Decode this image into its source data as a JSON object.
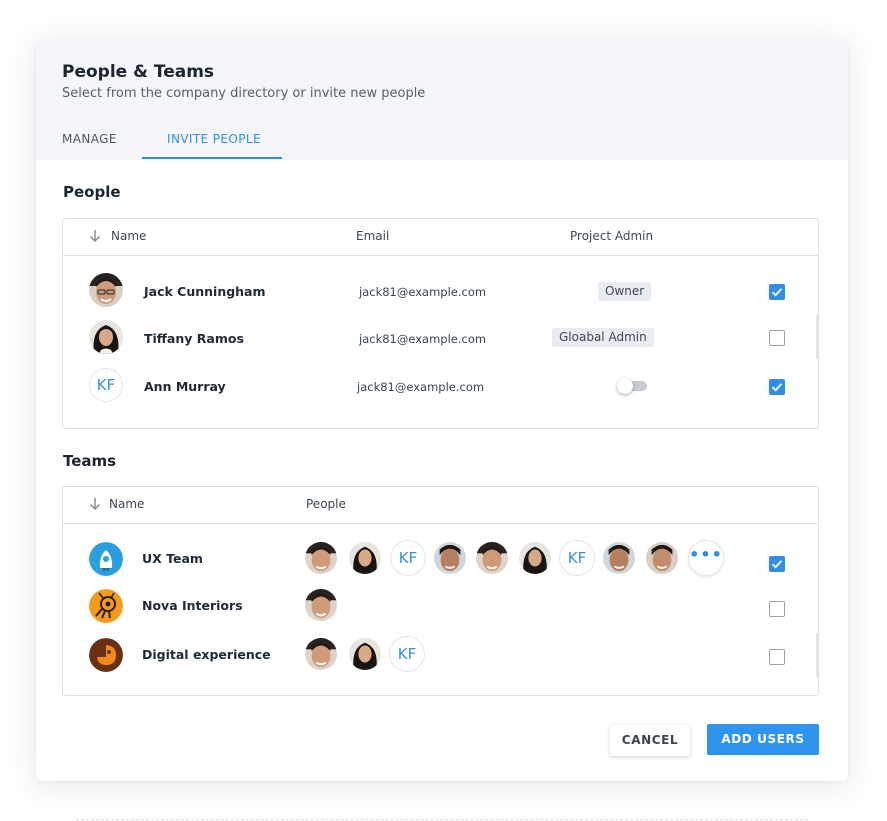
{
  "dialog": {
    "title": "People & Teams",
    "subtitle": "Select from the company directory or invite new people",
    "tabs": [
      {
        "label": "MANAGE",
        "active": false
      },
      {
        "label": "INVITE PEOPLE",
        "active": true
      }
    ]
  },
  "people": {
    "section_title": "People",
    "columns": {
      "name": "Name",
      "email": "Email",
      "admin": "Project Admin"
    },
    "rows": [
      {
        "name": "Jack Cunningham",
        "email": "jack81@example.com",
        "admin_badge": "Owner",
        "checked": true
      },
      {
        "name": "Tiffany Ramos",
        "email": "jack81@example.com",
        "admin_badge": "Gloabal Admin",
        "checked": false
      },
      {
        "name": "Ann Murray",
        "email": "jack81@example.com",
        "avatar_initials": "KF",
        "admin_toggle": false,
        "checked": true
      }
    ]
  },
  "teams": {
    "section_title": "Teams",
    "columns": {
      "name": "Name",
      "people": "People"
    },
    "rows": [
      {
        "name": "UX Team",
        "checked": true,
        "member_initials": "KF",
        "more_label": "•••"
      },
      {
        "name": "Nova Interiors",
        "checked": false
      },
      {
        "name": "Digital experience",
        "checked": false,
        "member_initials": "KF"
      }
    ]
  },
  "actions": {
    "cancel": "CANCEL",
    "add": "ADD USERS"
  },
  "colors": {
    "accent": "#2f8fe8",
    "header_bg": "#f4f6f9",
    "badge_bg": "#e9edf1"
  }
}
